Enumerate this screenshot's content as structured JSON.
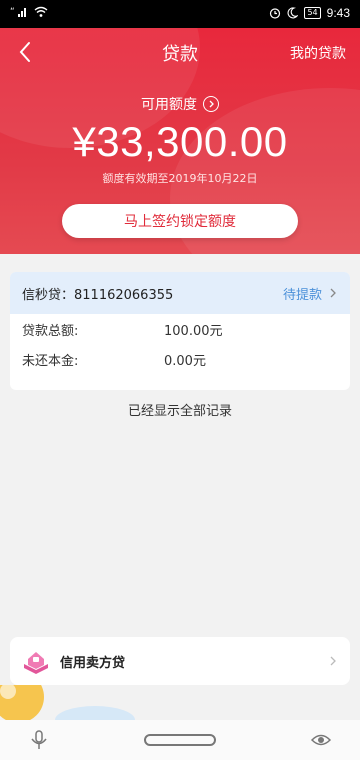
{
  "status_bar": {
    "carrier_icons": "“ıl",
    "battery": "54",
    "time": "9:43"
  },
  "header": {
    "title": "贷款",
    "right_link": "我的贷款"
  },
  "credit": {
    "label": "可用额度",
    "amount": "¥33,300.00",
    "validity": "额度有效期至2019年10月22日",
    "cta_label": "马上签约锁定额度"
  },
  "loan_card": {
    "account": "信秒贷：811162066355",
    "status": "待提款",
    "rows": [
      {
        "label": "贷款总额:",
        "value": "100.00元"
      },
      {
        "label": "未还本金:",
        "value": "0.00元"
      }
    ]
  },
  "list_footer": "已经显示全部记录",
  "promo": {
    "label": "信用卖方贷"
  },
  "colors": {
    "brand_red": "#e8283c",
    "link_blue": "#4a90d9",
    "card_header_bg": "#e3eefb"
  },
  "icons": [
    "back-arrow-icon",
    "info-circle-icon",
    "chevron-right-icon",
    "promo-box-icon",
    "mic-icon",
    "eye-icon",
    "alarm-icon",
    "moon-icon",
    "wifi-icon",
    "signal-icon"
  ]
}
